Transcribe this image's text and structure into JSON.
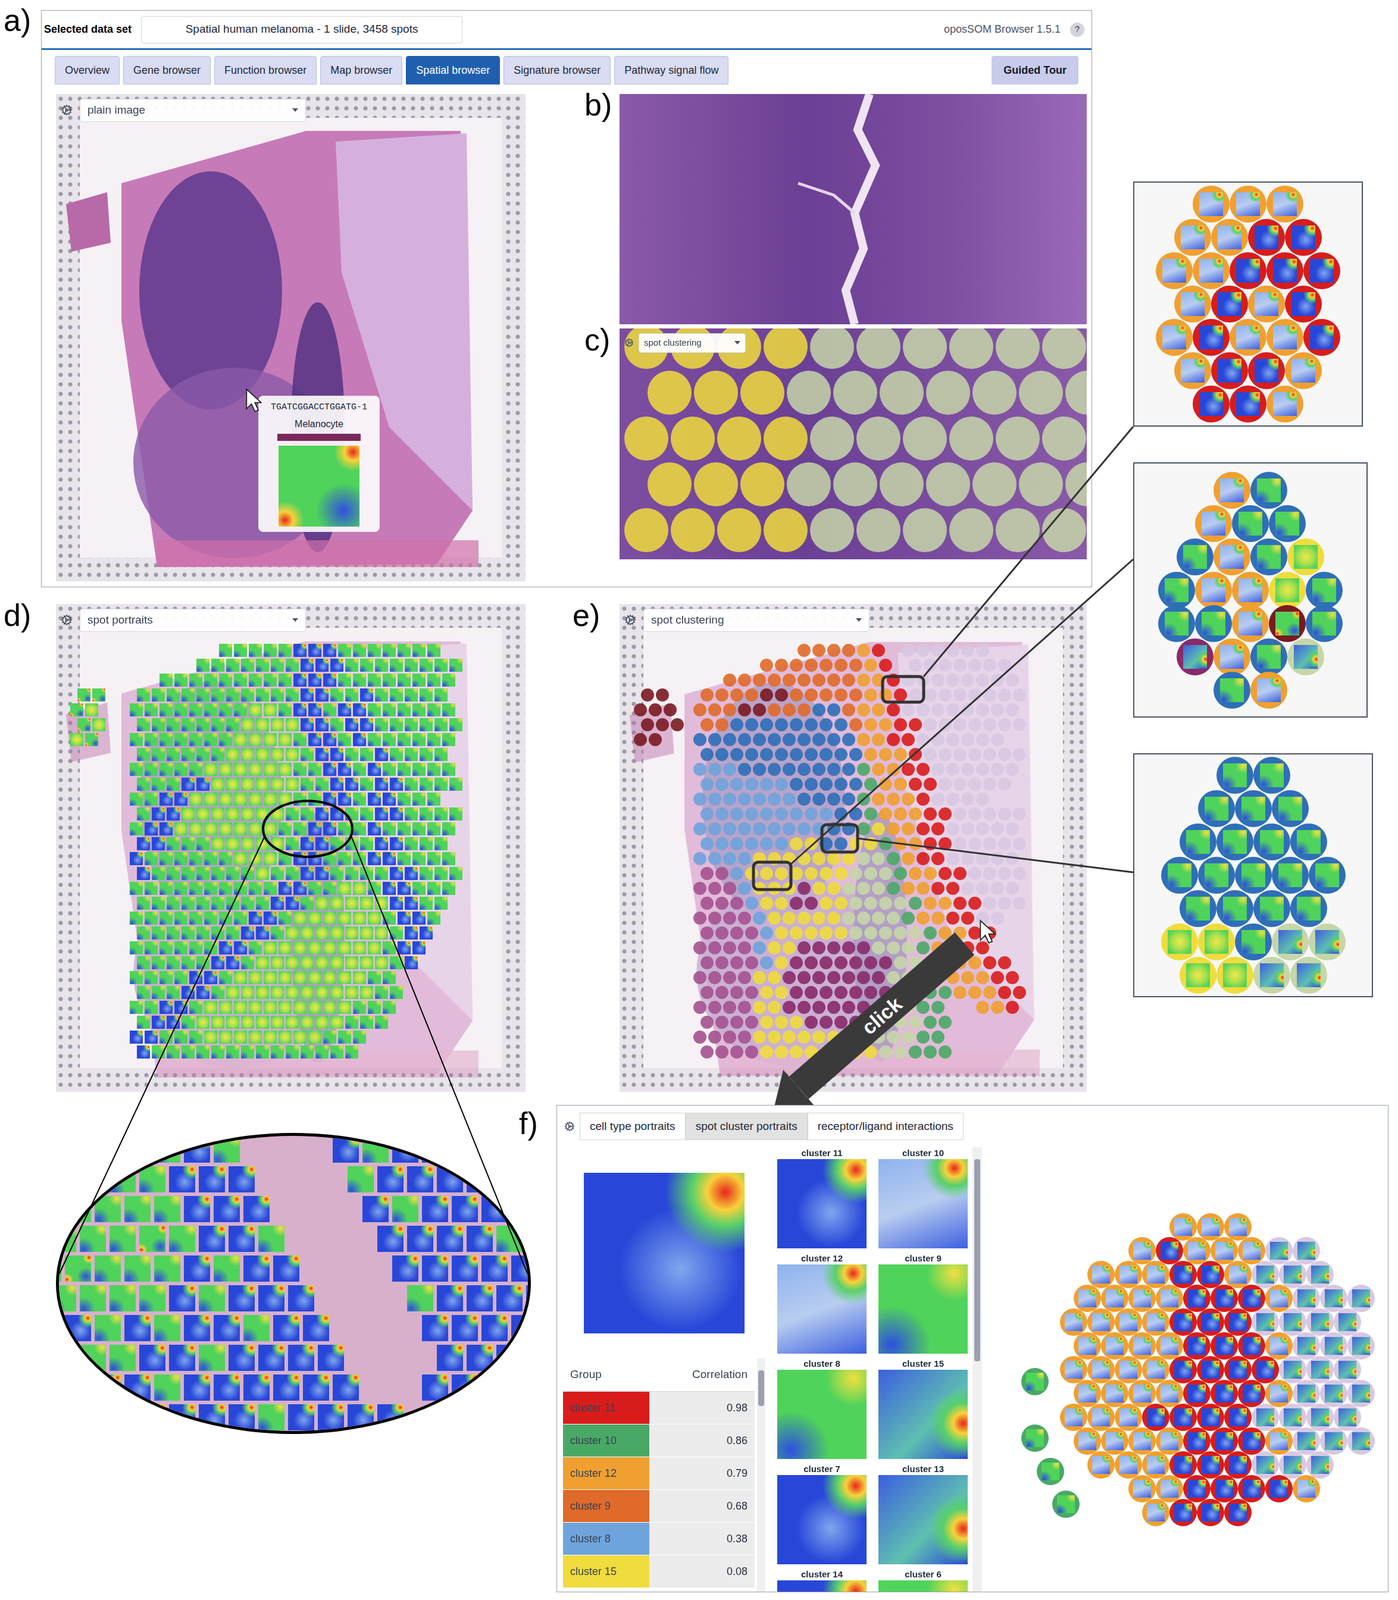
{
  "panel_labels": {
    "a": "a)",
    "b": "b)",
    "c": "c)",
    "d": "d)",
    "e": "e)",
    "f": "f)"
  },
  "browser": {
    "dataset_label": "Selected data set",
    "dataset": "Spatial human melanoma - 1 slide, 3458 spots",
    "version": "oposSOM Browser 1.5.1",
    "help": "?",
    "tabs": [
      {
        "label": "Overview",
        "selected": false
      },
      {
        "label": "Gene browser",
        "selected": false
      },
      {
        "label": "Function browser",
        "selected": false
      },
      {
        "label": "Map browser",
        "selected": false
      },
      {
        "label": "Spatial browser",
        "selected": true
      },
      {
        "label": "Signature browser",
        "selected": false
      },
      {
        "label": "Pathway signal flow",
        "selected": false
      }
    ],
    "guided_tour": "Guided Tour"
  },
  "palette": {
    "R": "#d81c1c",
    "O": "#f0a030",
    "D": "#e06a2a",
    "B": "#2e6fb8",
    "L": "#6fa3dc",
    "Y": "#f0dc3c",
    "S": "#c6d6a8",
    "G": "#4aa866",
    "P": "#8a2a6a",
    "M": "#7a1a22",
    "K": "#a4528f",
    "V": "#d8c8e2"
  },
  "portrait_of": {
    "R": "b",
    "O": "l",
    "D": "b",
    "B": "g",
    "L": "g",
    "Y": "y",
    "S": "n",
    "G": "g",
    "P": "n",
    "M": "r",
    "K": "n",
    "V": "n"
  },
  "panel_a": {
    "view": "plain image",
    "tooltip": {
      "barcode": "TGATCGGACCTGGATG-1",
      "cell_type": "Melanocyte",
      "color": "#7a2a5a",
      "portrait": "r"
    }
  },
  "panel_c": {
    "view": "spot clustering",
    "rows": [
      "YYYYSSSSSS",
      "YYYSSSSSSS",
      "YYYYSSSSSS",
      "YYYSSSSSSS",
      "YYYYSSSSSS"
    ]
  },
  "panel_d": {
    "view": "spot portraits",
    "map": [
      "..........gggggbbbggggggg.",
      "........gggggggbbbgggggggg",
      "......gggggggggbbbgggggggg",
      "rr..gggggggggggbbggbggggg.",
      "ry..ggggggggyygbbgbbgggggg",
      "ry..gggggggyyyybbgbbgggggg",
      "yr..gggggggyyyygbbgbgggggg",
      "....ggggggyyyyygbbggbgggg.",
      "....gggggyyyyyyggbbgbggggg",
      "....gggbbyyyyyyggbbgbbgggg",
      "....ggbbyyyyyyyggbbgbbggg.",
      "....gbbyyyyyyyggbbggbbgggg",
      "....gbbyyyyyyyggbbggbggggg",
      "....bbgggyyyyygbbgggbbggg.",
      "....bggggggyyygbbgggbbgggg",
      "....bgggggggyggbbggggbbggg",
      "....ggggggggggbbggyygbbggg",
      "....gggggggggbbgyyyyybbgg.",
      "....ggggggggbbgyyyyyygbbg.",
      "....gggggggbbgyyyyyyygbb..",
      "....ggggggbbgyyyyyyyygbb..",
      "....gggggbbgyyyyyyyyygb...",
      "....ggggbbgyyyyyyyyygg....",
      "....gggbbgyyyyyyyyyygg....",
      "....ggbbgyyyyyyyyyyggg....",
      "....gbbgyyyyyyyyyyggg.....",
      "....bbgggyyyyyyyyggg......",
      "....bgggggggggggggg......."
    ],
    "zoom": [
      "rggbgbg...bgbbbbb",
      "grggbbb...gbbbbbb",
      "rggggbbb...bgbbbb",
      "gggrgbbg...bbbbgb",
      "grgggbgbb...bbbbb",
      "ggggbgbbb...gbbbb",
      "gbgbgbbgbb...bbbb",
      "bggbbgbbbb...bbbb",
      "gbbbgbbbbbb..bbbr",
      "bbgbbbbgbbbb..bbr"
    ]
  },
  "panel_e": {
    "view": "spot clustering",
    "map": [
      "...........DDDDOR.VVVVVV..",
      "........DDDDDDDOR.VVVVVVV.",
      "......DDDDDDDDDOORVVVVVVVV",
      "MM..DDDDMMDDDDDOORVVVVVVVV",
      "MMM.DDDMMDDDBBDOORVVVVVVVV",
      "MMM.DDBBBBBBBBDOORRVVVVVVV",
      "MM..BBBBBBBBBBBOORRVVVVVV.",
      "....BBBBBBBBBBBOOORVVVVVVV",
      "....LLLBBBBBBBBGOORRVVVVVV",
      "....LLLLLLBBBBBGOORRVVVVV.",
      "....LLLLLLLBBBBGOOORVVVV..",
      "....LLLLLLLLLBBGOOORRVVVVV",
      "....LLLLLLLLLBBGYOORRVVVVV",
      "....LLLLLLYYBBYYGOORRVVVVV",
      "....LLLLYYYYYYYSSGORRVVVVV",
      "....KKLYYYYYYYSSSGOORRVVVV",
      "....KKKLYYYPYYSSSGOORRVVVV",
      "....KKKLYYPPYYSSSSGOORRVVV",
      "....KKKKLYYYYYSSSSGOORRVV.",
      "....KKKKLYYYYYSSSSSGOORR..",
      "....KKKKLYYPPPPPSSSGOORR..",
      "....KKKKLYPPPPPPPSSGOOORR.",
      "....KKKKYYPPPPPPPSSGGOOORR",
      "....KKKKYYPPPPPPPSSGGOOORR",
      "....KKKKYYPPPPPPSSSGG..OOR",
      "....KKKKYYYPPPPSSSSGG.....",
      "....KKKKYYYYYYYSSSSGG.....",
      "....KKKKYYYYYYYYSSGGG....."
    ]
  },
  "insets": [
    {
      "rows": [
        "OOO",
        "OORR",
        "OORRR",
        "OROR",
        "OROOR",
        "ORRO",
        "RRO"
      ]
    },
    {
      "rows": [
        "OB",
        "OBB",
        "BOBY",
        "BOOYB",
        "BBOMB",
        "POBS",
        "BO"
      ]
    },
    {
      "rows": [
        "BB",
        "BBB",
        "BBBB",
        "BBBBB",
        "BBBB",
        "YYBSS",
        "YYSS"
      ]
    }
  ],
  "click_label": "click",
  "panel_f": {
    "tabs": [
      {
        "label": "cell type portraits",
        "selected": false
      },
      {
        "label": "spot cluster portraits",
        "selected": true
      },
      {
        "label": "receptor/ligand interactions",
        "selected": false
      }
    ],
    "selected_portrait": "b",
    "table": {
      "columns": [
        "Group",
        "Correlation"
      ],
      "rows": [
        {
          "group": "cluster 11",
          "correlation": "0.98",
          "color": "#d81c1c"
        },
        {
          "group": "cluster 10",
          "correlation": "0.86",
          "color": "#4aa866"
        },
        {
          "group": "cluster 12",
          "correlation": "0.79",
          "color": "#f0a030"
        },
        {
          "group": "cluster 9",
          "correlation": "0.68",
          "color": "#e06a2a"
        },
        {
          "group": "cluster 8",
          "correlation": "0.38",
          "color": "#6fa3dc"
        },
        {
          "group": "cluster 15",
          "correlation": "0.08",
          "color": "#f0dc3c"
        }
      ]
    },
    "portraits": [
      {
        "label": "cluster 11",
        "portrait": "b"
      },
      {
        "label": "cluster 10",
        "portrait": "l"
      },
      {
        "label": "cluster 12",
        "portrait": "l"
      },
      {
        "label": "cluster 9",
        "portrait": "g"
      },
      {
        "label": "cluster 8",
        "portrait": "g"
      },
      {
        "label": "cluster 15",
        "portrait": "n"
      },
      {
        "label": "cluster 7",
        "portrait": "b"
      },
      {
        "label": "cluster 13",
        "portrait": "n"
      },
      {
        "label": "cluster 14",
        "portrait": "b"
      },
      {
        "label": "cluster 6",
        "portrait": "g"
      }
    ],
    "hex": [
      "....OOO....",
      "..OROOOVV..",
      ".OOORROVVV.",
      "OOOORRROVVV",
      "OOOORRRVVVV",
      "OOOORRROVVV",
      "OOOORRRRVVV",
      "OOOORRROVVV",
      "OOORRRRVVVV",
      "OOOORRROVVV",
      ".OOORRRVVV.",
      "..OORRRRO..",
      "...ORRR...."
    ],
    "stray": [
      "G",
      "G",
      "G",
      "G"
    ]
  }
}
